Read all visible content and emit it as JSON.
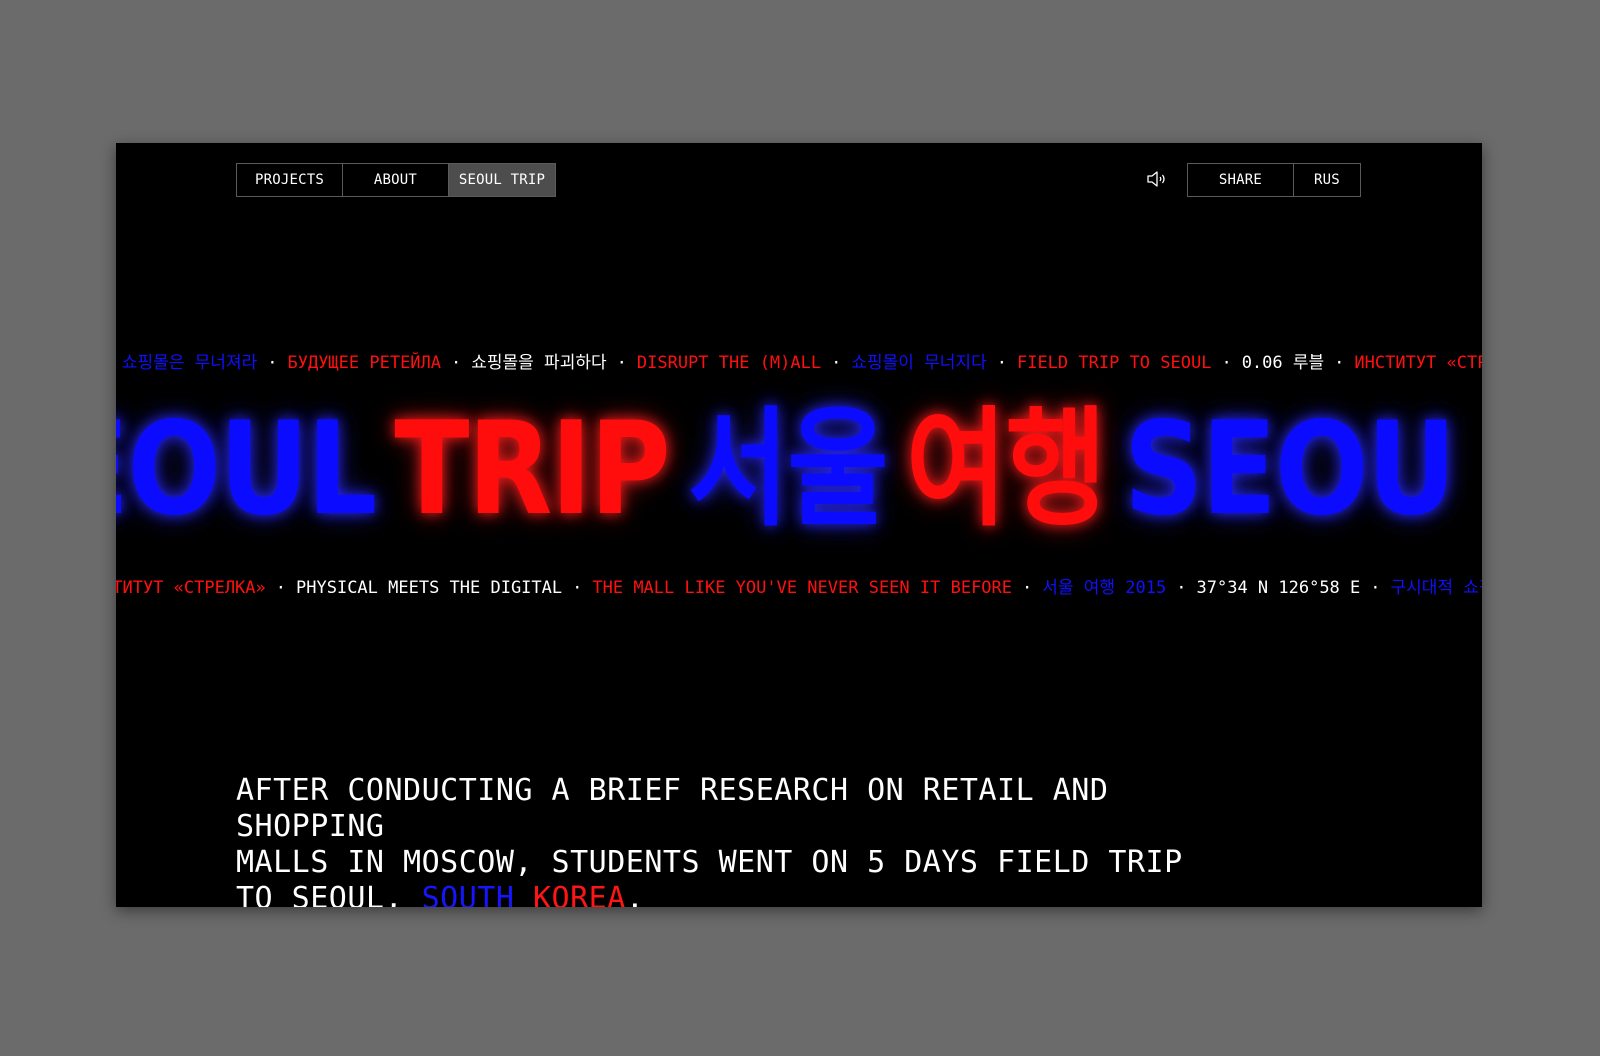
{
  "nav": {
    "left": [
      "PROJECTS",
      "ABOUT",
      "SEOUL TRIP"
    ],
    "right": [
      "SHARE",
      "RUS"
    ]
  },
  "ticker_top": [
    {
      "text": "직 쇼핑몰은 무너져라",
      "color": "blue"
    },
    {
      "text": "БУДУЩЕЕ РЕТЕЙЛА",
      "color": "red"
    },
    {
      "text": "쇼핑몰을 파괴하다",
      "color": "white"
    },
    {
      "text": "DISRUPT THE (M)ALL",
      "color": "red"
    },
    {
      "text": "쇼핑몰이 무너지다",
      "color": "blue"
    },
    {
      "text": "FIELD TRIP TO SEOUL",
      "color": "red"
    },
    {
      "text": "0.06 루블",
      "color": "white"
    },
    {
      "text": "ИНСТИТУТ «СТРЕЛК",
      "color": "red"
    }
  ],
  "headline": [
    {
      "text": "EOUL",
      "color": "blue"
    },
    {
      "text": "TRIP",
      "color": "red"
    },
    {
      "text": "서울",
      "color": "blue"
    },
    {
      "text": "여행",
      "color": "red"
    },
    {
      "text": "SEOU",
      "color": "blue"
    }
  ],
  "ticker_bottom": [
    {
      "text": "СТИТУТ «СТРЕЛКА»",
      "color": "red"
    },
    {
      "text": "PHYSICAL MEETS THE DIGITAL",
      "color": "white"
    },
    {
      "text": "THE MALL LIKE YOU'VE NEVER SEEN IT BEFORE",
      "color": "red"
    },
    {
      "text": "서울 여행 2015",
      "color": "blue"
    },
    {
      "text": "37°34 N 126°58 E",
      "color": "white"
    },
    {
      "text": "구시대적 쇼핑몰은",
      "color": "blue"
    }
  ],
  "description": {
    "line1": "AFTER CONDUCTING A BRIEF RESEARCH ON RETAIL AND SHOPPING",
    "line2": "MALLS IN MOSCOW, STUDENTS WENT ON 5 DAYS FIELD TRIP",
    "line3_prefix": "TO SEOUL, ",
    "highlight_blue": "SOUTH",
    "highlight_red": "KOREA",
    "suffix": "."
  },
  "icons": {
    "sound": "speaker-icon"
  },
  "colors": {
    "blue": "#0b0bff",
    "red": "#ff0c0c",
    "background": "#000000",
    "nav_active": "#4d4d4d"
  }
}
